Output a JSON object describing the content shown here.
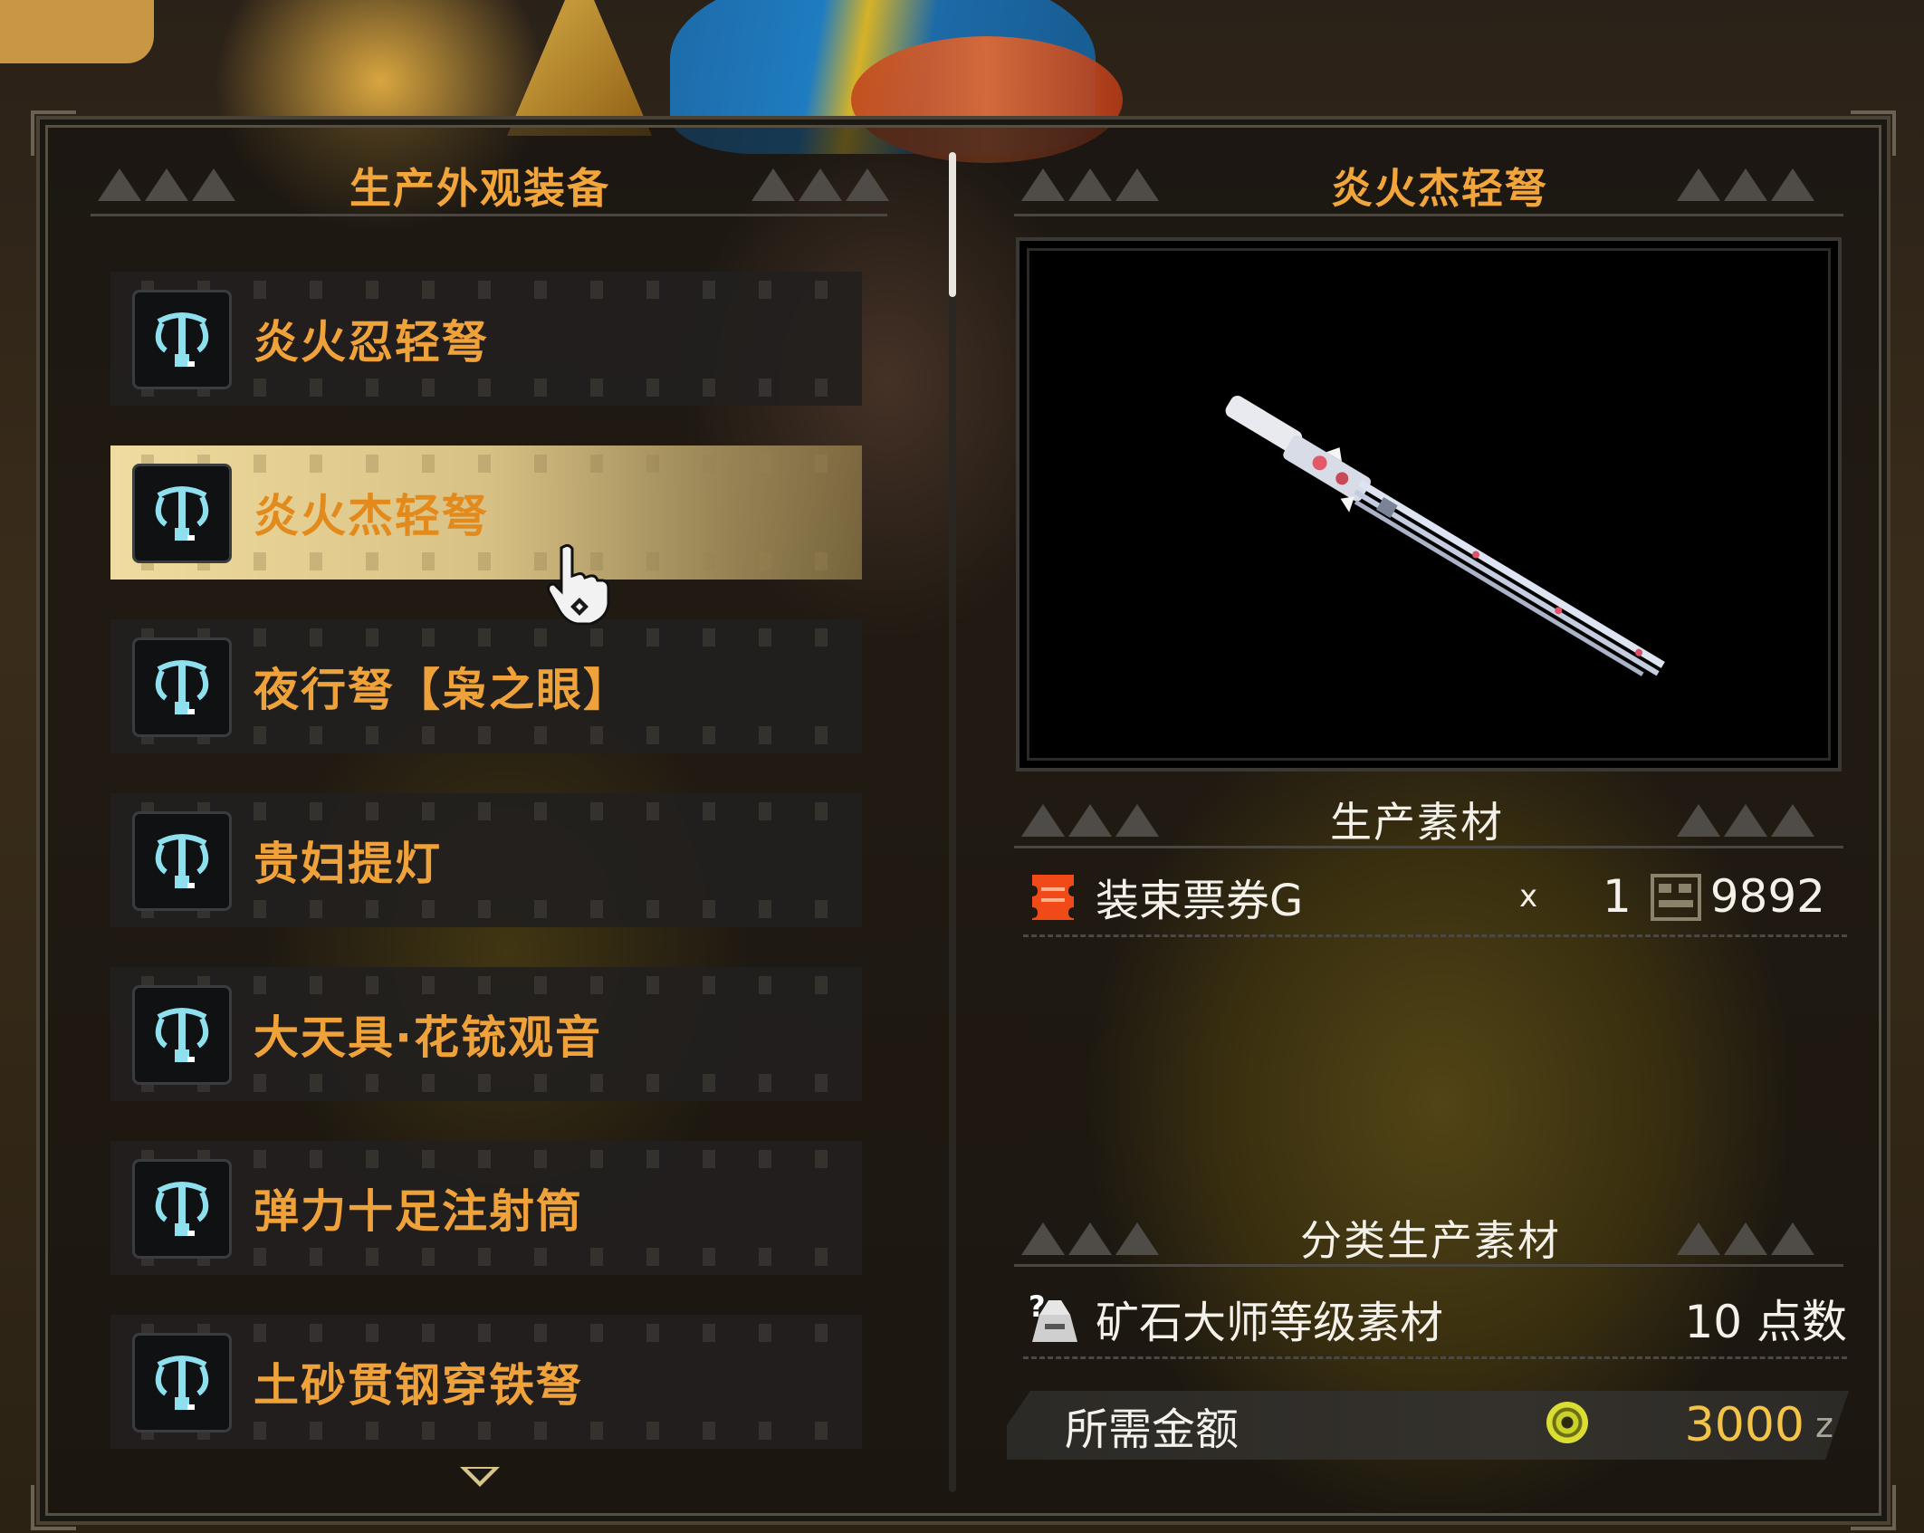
{
  "left_panel": {
    "title": "生产外观装备",
    "items": [
      {
        "label": "炎火忍轻弩",
        "selected": false
      },
      {
        "label": "炎火杰轻弩",
        "selected": true
      },
      {
        "label": "夜行弩【枭之眼】",
        "selected": false
      },
      {
        "label": "贵妇提灯",
        "selected": false
      },
      {
        "label": "大天具·花铳观音",
        "selected": false
      },
      {
        "label": "弹力十足注射筒",
        "selected": false
      },
      {
        "label": "土砂贯钢穿铁弩",
        "selected": false
      }
    ],
    "item_icon": "light-bowgun-icon"
  },
  "right_panel": {
    "title": "炎火杰轻弩",
    "materials_header": "生产素材",
    "material": {
      "name": "装束票券G",
      "x": "x",
      "qty": "1",
      "owned": "9892",
      "icon": "ticket-icon"
    },
    "category_header": "分类生产素材",
    "category_material": {
      "name": "矿石大师等级素材",
      "points": "10 点数",
      "icon": "ore-category-icon"
    },
    "cost_label": "所需金额",
    "cost_value": "3000",
    "cost_unit": "z"
  },
  "colors": {
    "accent": "#f0a23a",
    "selected_bg": "#e8d49a",
    "text": "#f4f1ea",
    "gold": "#f3c447"
  }
}
